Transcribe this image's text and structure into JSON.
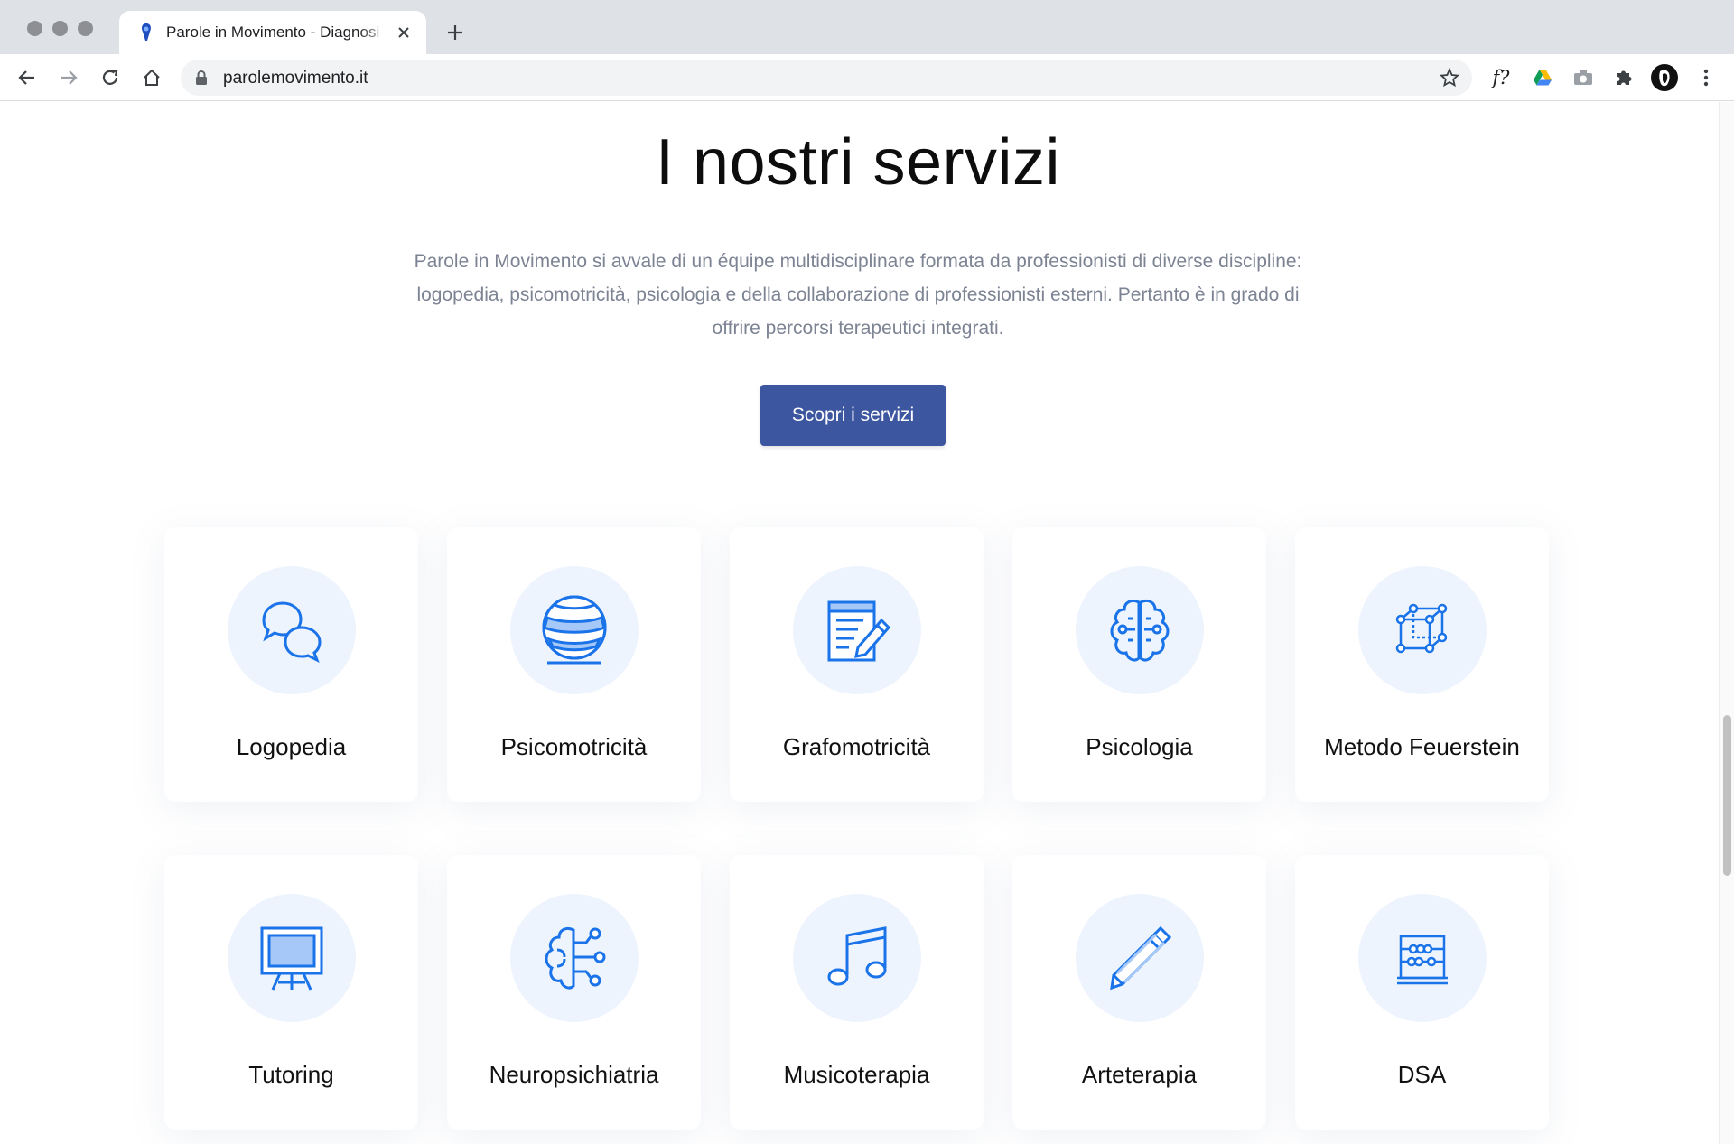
{
  "browser": {
    "tab_title": "Parole in Movimento - Diagnosi",
    "url": "parolemovimento.it"
  },
  "services": {
    "title": "I nostri servizi",
    "description": "Parole in Movimento si avvale di un équipe multidisciplinare formata da professionisti di diverse discipline: logopedia, psicomotricità, psicologia e della collaborazione di professionisti esterni. Pertanto è in grado di offrire percorsi terapeutici integrati.",
    "cta_label": "Scopri i servizi",
    "items": [
      {
        "label": "Logopedia",
        "icon": "speech-bubbles-icon"
      },
      {
        "label": "Psicomotricità",
        "icon": "ball-icon"
      },
      {
        "label": "Grafomotricità",
        "icon": "document-pen-icon"
      },
      {
        "label": "Psicologia",
        "icon": "brain-icon"
      },
      {
        "label": "Metodo Feuerstein",
        "icon": "cube-network-icon"
      },
      {
        "label": "Tutoring",
        "icon": "easel-board-icon"
      },
      {
        "label": "Neuropsichiatria",
        "icon": "brain-circuit-icon"
      },
      {
        "label": "Musicoterapia",
        "icon": "music-note-icon"
      },
      {
        "label": "Arteterapia",
        "icon": "pencil-icon"
      },
      {
        "label": "DSA",
        "icon": "abacus-icon"
      }
    ]
  },
  "colors": {
    "accent": "#3d56a0",
    "icon_blue": "#1a73e8",
    "icon_circle_bg": "#edf4fd"
  }
}
